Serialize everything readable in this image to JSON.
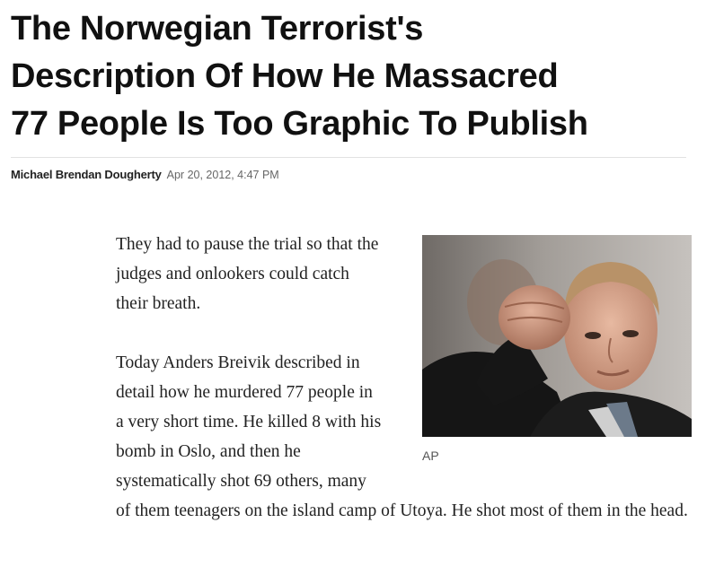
{
  "article": {
    "headline_lines": [
      "The Norwegian Terrorist's",
      "Description Of How He Massacred",
      "77 People Is Too Graphic To Publish"
    ],
    "author": "Michael Brendan Dougherty",
    "date": "Apr 20, 2012, 4:47 PM",
    "image_credit": "AP",
    "paragraphs": [
      "They had to pause the trial so that the judges and onlookers could catch their breath.",
      "Today Anders Breivik described in detail how he murdered 77 people in a very short time. He killed 8 with his bomb in Oslo, and then he systematically shot 69 others, many of them teenagers on the island camp of Utoya. He shot most of them in the head."
    ]
  }
}
